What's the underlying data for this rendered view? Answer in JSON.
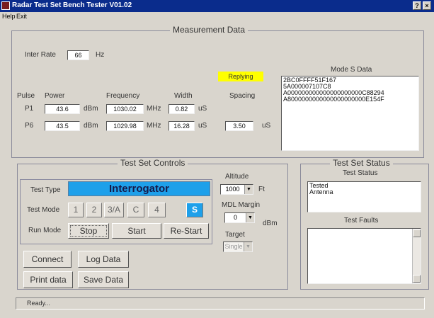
{
  "window": {
    "title": "Radar Test Set Bench Tester V01.02"
  },
  "titlebar": {
    "help_label": "?",
    "close_label": "×"
  },
  "menu": {
    "help": "Help",
    "exit": "Exit"
  },
  "measurement": {
    "title": "Measurement Data",
    "inter_rate_label": "Inter Rate",
    "inter_rate_value": "66",
    "inter_rate_unit": "Hz",
    "replying_label": "Replying",
    "headers": {
      "pulse": "Pulse",
      "power": "Power",
      "frequency": "Frequency",
      "width": "Width",
      "spacing": "Spacing"
    },
    "p1": {
      "label": "P1",
      "power": "43.6",
      "power_unit": "dBm",
      "frequency": "1030.02",
      "frequency_unit": "MHz",
      "width": "0.82",
      "width_unit": "uS"
    },
    "p6": {
      "label": "P6",
      "power": "43.5",
      "power_unit": "dBm",
      "frequency": "1029.98",
      "frequency_unit": "MHz",
      "width": "16.28",
      "width_unit": "uS",
      "spacing": "3.50",
      "spacing_unit": "uS"
    },
    "mode_s_title": "Mode S Data",
    "mode_s_lines": [
      "2BC0FFFF51F167",
      "5A000007107C8",
      "A000000000000000000000C88294",
      "A8000000000000000000000E154F"
    ]
  },
  "controls": {
    "title": "Test Set Controls",
    "test_type_label": "Test Type",
    "test_type_value": "Interrogator",
    "test_mode_label": "Test Mode",
    "modes": [
      "1",
      "2",
      "3/A",
      "C",
      "4",
      "S"
    ],
    "run_mode_label": "Run Mode",
    "stop": "Stop",
    "start": "Start",
    "restart": "Re-Start",
    "altitude_label": "Altitude",
    "altitude_value": "1000",
    "altitude_unit": "Ft",
    "mdl_label": "MDL Margin",
    "mdl_value": "0",
    "mdl_unit": "dBm",
    "target_label": "Target",
    "target_value": "Single",
    "connect": "Connect",
    "log_data": "Log Data",
    "print_data": "Print data",
    "save_data": "Save Data"
  },
  "status": {
    "title": "Test Set Status",
    "test_status_label": "Test Status",
    "test_status_lines": [
      "Tested",
      "Antenna"
    ],
    "test_faults_label": "Test Faults"
  },
  "statusbar": {
    "text": "Ready..."
  },
  "colors": {
    "title_bg": "#0a2c8c",
    "replying_bg": "#ffff00",
    "interrogator_bg": "#1ea0ea",
    "mode_s_bg": "#1ea0ea"
  }
}
